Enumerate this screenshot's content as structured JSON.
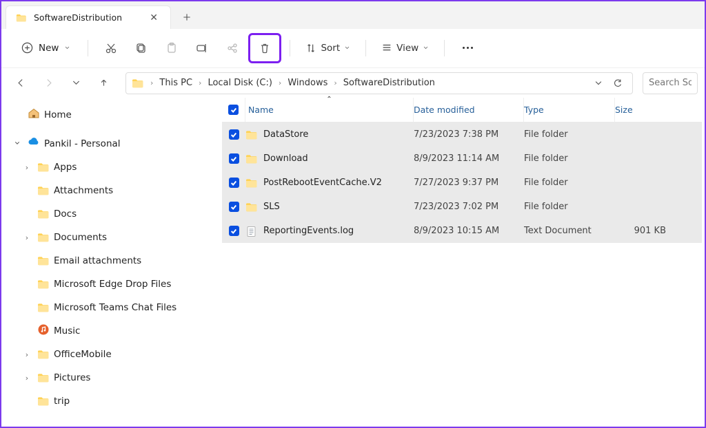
{
  "tab": {
    "title": "SoftwareDistribution"
  },
  "toolbar": {
    "new_label": "New",
    "sort_label": "Sort",
    "view_label": "View"
  },
  "breadcrumb": [
    "This PC",
    "Local Disk (C:)",
    "Windows",
    "SoftwareDistribution"
  ],
  "search_placeholder": "Search SoftwareDistribution",
  "tree": {
    "home": "Home",
    "onedrive": "Pankil - Personal",
    "children": [
      "Apps",
      "Attachments",
      "Docs",
      "Documents",
      "Email attachments",
      "Microsoft Edge Drop Files",
      "Microsoft Teams Chat Files",
      "Music",
      "OfficeMobile",
      "Pictures",
      "trip"
    ]
  },
  "columns": {
    "name": "Name",
    "date": "Date modified",
    "type": "Type",
    "size": "Size"
  },
  "rows": [
    {
      "name": "DataStore",
      "date": "7/23/2023 7:38 PM",
      "type": "File folder",
      "size": "",
      "icon": "folder",
      "selected": true
    },
    {
      "name": "Download",
      "date": "8/9/2023 11:14 AM",
      "type": "File folder",
      "size": "",
      "icon": "folder",
      "selected": true
    },
    {
      "name": "PostRebootEventCache.V2",
      "date": "7/27/2023 9:37 PM",
      "type": "File folder",
      "size": "",
      "icon": "folder",
      "selected": true
    },
    {
      "name": "SLS",
      "date": "7/23/2023 7:02 PM",
      "type": "File folder",
      "size": "",
      "icon": "folder",
      "selected": true
    },
    {
      "name": "ReportingEvents.log",
      "date": "8/9/2023 10:15 AM",
      "type": "Text Document",
      "size": "901 KB",
      "icon": "text",
      "selected": true
    }
  ]
}
